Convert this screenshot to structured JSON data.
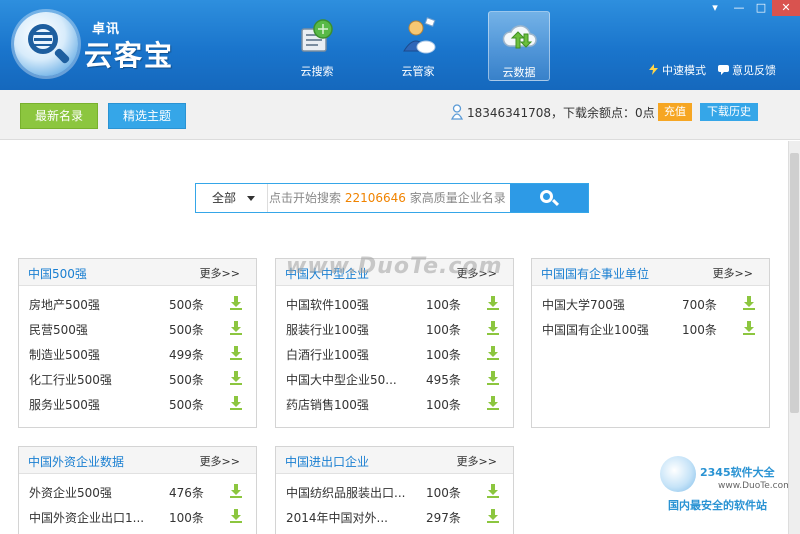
{
  "app": {
    "brand_small": "卓讯",
    "brand_name": "云客宝"
  },
  "nav": {
    "tabs": [
      {
        "label": "云搜索",
        "icon": "cloud-search-icon",
        "active": false
      },
      {
        "label": "云管家",
        "icon": "cloud-butler-icon",
        "active": false
      },
      {
        "label": "云数据",
        "icon": "cloud-data-icon",
        "active": true
      }
    ]
  },
  "window": {
    "controls": [
      "▾",
      "—",
      "□",
      "✕"
    ]
  },
  "header_actions": {
    "speed_mode": "中速模式",
    "feedback": "意见反馈"
  },
  "toolbar": {
    "latest_list": "最新名录",
    "selected_topics": "精选主题",
    "phone": "18346341708",
    "remaining_label": "，下载余额点：",
    "remaining_value": "0点",
    "recharge": "充值",
    "download_history": "下载历史"
  },
  "search": {
    "scope": "全部",
    "placeholder_prefix": "点击开始搜索",
    "count": "22106646",
    "placeholder_suffix": "家高质量企业名录"
  },
  "cards": [
    {
      "title": "中国500强",
      "more": "更多>>",
      "rows": [
        {
          "name": "房地产500强",
          "count": "500条"
        },
        {
          "name": "民营500强",
          "count": "500条"
        },
        {
          "name": "制造业500强",
          "count": "499条"
        },
        {
          "name": "化工行业500强",
          "count": "500条"
        },
        {
          "name": "服务业500强",
          "count": "500条"
        }
      ]
    },
    {
      "title": "中国大中型企业",
      "more": "更多>>",
      "rows": [
        {
          "name": "中国软件100强",
          "count": "100条"
        },
        {
          "name": "服装行业100强",
          "count": "100条"
        },
        {
          "name": "白酒行业100强",
          "count": "100条"
        },
        {
          "name": "中国大中型企业50...",
          "count": "495条"
        },
        {
          "name": "药店销售100强",
          "count": "100条"
        }
      ]
    },
    {
      "title": "中国国有企事业单位",
      "more": "更多>>",
      "rows": [
        {
          "name": "中国大学700强",
          "count": "700条"
        },
        {
          "name": "中国国有企业100强",
          "count": "100条"
        }
      ]
    },
    {
      "title": "中国外资企业数据",
      "more": "更多>>",
      "rows": [
        {
          "name": "外资企业500强",
          "count": "476条"
        },
        {
          "name": "中国外资企业出口1...",
          "count": "100条"
        }
      ]
    },
    {
      "title": "中国进出口企业",
      "more": "更多>>",
      "rows": [
        {
          "name": "中国纺织品服装出口...",
          "count": "100条"
        },
        {
          "name": "2014年中国对外...",
          "count": "297条"
        }
      ]
    }
  ],
  "watermarks": {
    "site": "www.DuoTe.com",
    "badge": "2345软件大全",
    "badge_url": "www.DuoTe.com",
    "badge_tag": "国内最安全的软件站"
  },
  "colors": {
    "header_blue": "#1a75cc",
    "accent_blue": "#35a6e8",
    "green": "#8cc63f",
    "orange": "#f6a623",
    "card_title": "#1a7fd1"
  }
}
